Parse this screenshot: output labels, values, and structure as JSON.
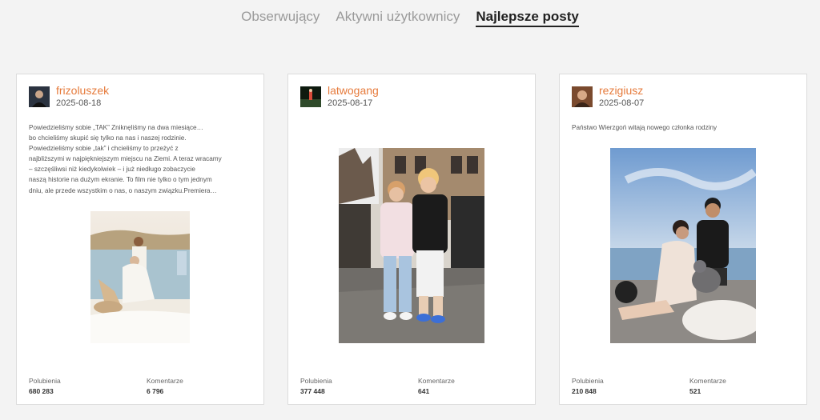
{
  "tabs": [
    {
      "label": "Obserwujący",
      "active": false
    },
    {
      "label": "Aktywni użytkownicy",
      "active": false
    },
    {
      "label": "Najlepsze posty",
      "active": true
    }
  ],
  "posts": [
    {
      "username": "frizoluszek",
      "date": "2025-08-18",
      "caption": [
        " Powiedzieliśmy sobie „TAK” Zniknęliśmy na dwa miesiące…",
        "bo chcieliśmy skupić się tylko na nas i naszej rodzinie.",
        "Powiedzieliśmy sobie „tak” i chcieliśmy to przeżyć z",
        "najbliższymi w najpiękniejszym miejscu na Ziemi. A teraz wracamy",
        "– szczęśliwsi niż kiedykolwiek – i już niedługo zobaczycie",
        "naszą historie na dużym ekranie. To film nie tylko o tym jednym",
        "dniu, ale przede wszystkim o nas, o naszym związku.Premiera…"
      ],
      "likes_label": "Polubienia",
      "likes": "680 283",
      "comments_label": "Komentarze",
      "comments": "6 796"
    },
    {
      "username": "latwogang",
      "date": "2025-08-17",
      "caption": [],
      "likes_label": "Polubienia",
      "likes": "377 448",
      "comments_label": "Komentarze",
      "comments": "641"
    },
    {
      "username": "rezigiusz",
      "date": "2025-08-07",
      "caption": [
        "Państwo Wierzgoń witają nowego członka rodziny"
      ],
      "likes_label": "Polubienia",
      "likes": "210 848",
      "comments_label": "Komentarze",
      "comments": "521"
    }
  ],
  "colors": {
    "accent": "#e67b3c",
    "background": "#f3f3f3",
    "card": "#ffffff"
  }
}
